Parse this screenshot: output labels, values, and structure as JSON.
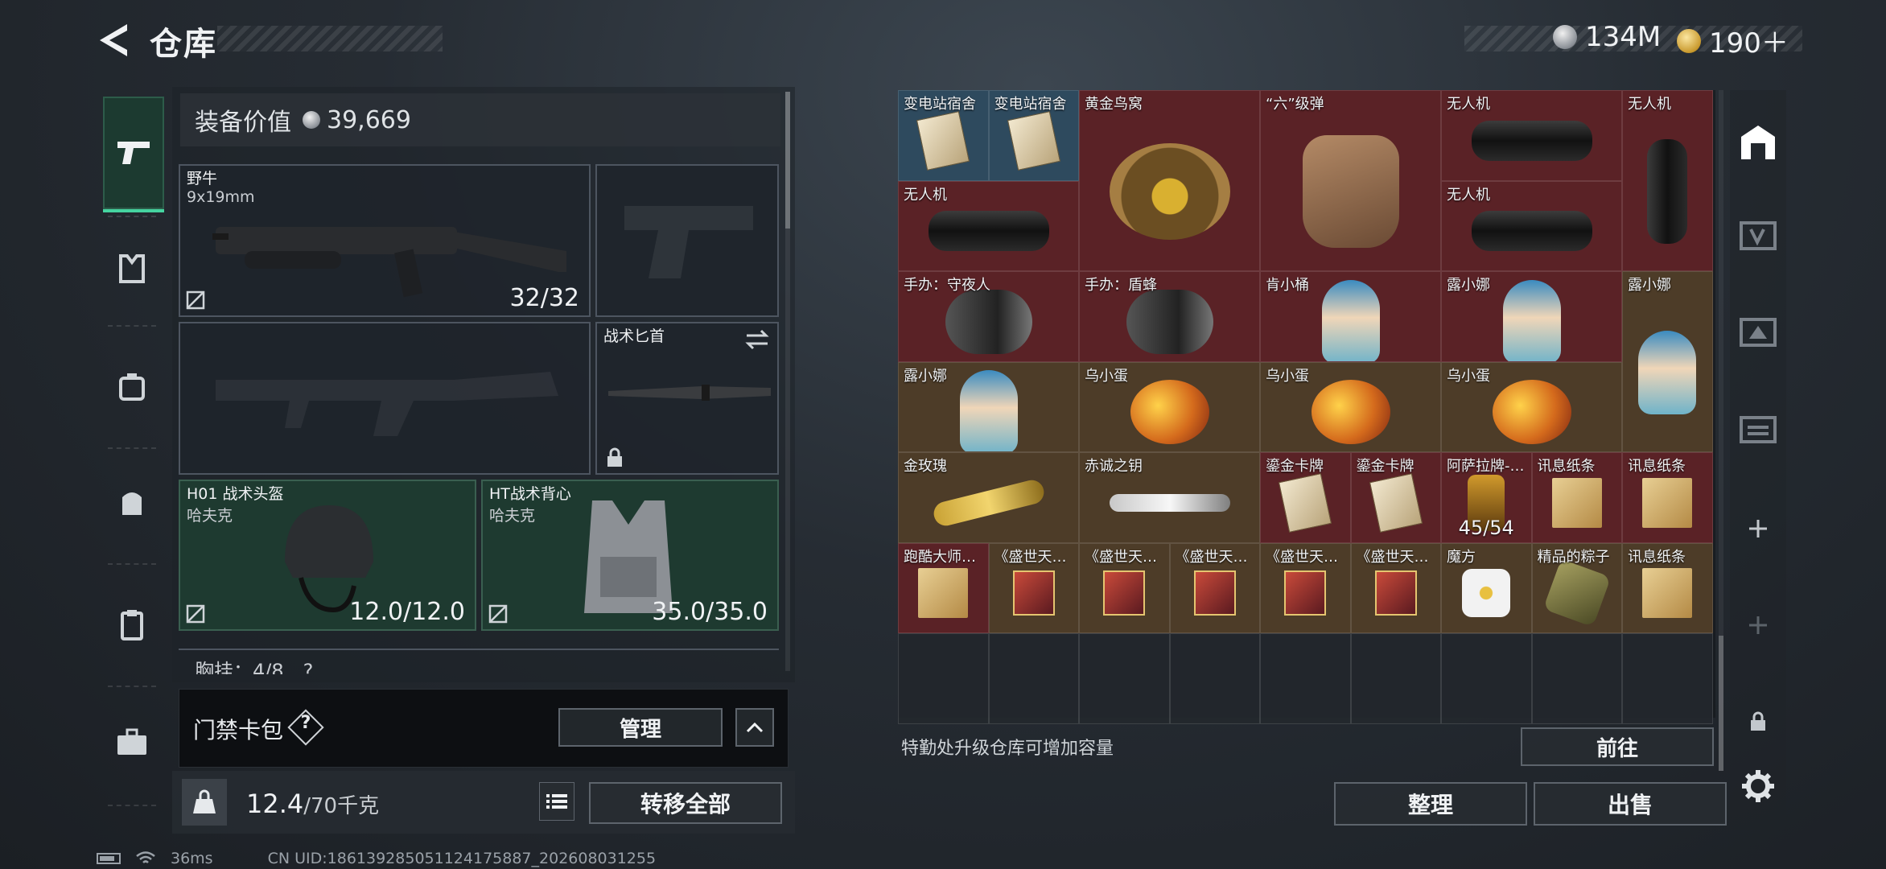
{
  "header": {
    "title": "仓库",
    "currency_silver": "134M",
    "currency_gold": "190＋"
  },
  "left_nav": {
    "items": [
      "weapon-icon",
      "armor-icon",
      "backpack-icon",
      "bag-icon",
      "vest-icon",
      "case-icon"
    ]
  },
  "equipment": {
    "value_label": "装备价值",
    "value": "39,669",
    "primary_weapon": {
      "name": "野牛",
      "caliber": "9x19mm",
      "durability": "32/32"
    },
    "melee": {
      "name": "战术匕首"
    },
    "helmet": {
      "name": "H01 战术头盔",
      "brand": "哈夫克",
      "durability": "12.0/12.0"
    },
    "armor": {
      "name": "HT战术背心",
      "brand": "哈夫克",
      "durability": "35.0/35.0"
    },
    "next_section_partial": "胸挂：4/8　?"
  },
  "keycard": {
    "label": "门禁卡包",
    "help": "?",
    "manage_button": "管理"
  },
  "weight": {
    "current": "12.4",
    "capacity": "/70千克",
    "transfer_button": "转移全部"
  },
  "warehouse": {
    "rows": [
      [
        {
          "label": "变电站宿舍",
          "art": "card",
          "bg": "blue"
        },
        {
          "label": "变电站宿舍",
          "art": "card",
          "bg": "blue"
        },
        {
          "label": "黄金鸟窝",
          "art": "nest",
          "bg": "red"
        },
        {
          "label": "“六”级弹",
          "art": "hand",
          "bg": "red"
        },
        {
          "label": "无人机",
          "art": "tube",
          "bg": "red"
        },
        {
          "label": "无人机",
          "art": "tube-v",
          "bg": "red"
        }
      ],
      [
        {
          "label": "无人机",
          "art": "tube",
          "bg": "red"
        },
        {
          "label": "无人机",
          "art": "tube",
          "bg": "red"
        }
      ],
      [
        {
          "label": "手办：守夜人",
          "art": "figd",
          "bg": "red"
        },
        {
          "label": "手办：盾蜂",
          "art": "figd",
          "bg": "red"
        },
        {
          "label": "肯小桶",
          "art": "fig",
          "bg": "red"
        },
        {
          "label": "露小娜",
          "art": "fig",
          "bg": "red"
        },
        {
          "label": "露小娜",
          "art": "fig",
          "bg": "gold"
        }
      ],
      [
        {
          "label": "露小娜",
          "art": "fig",
          "bg": "gold"
        },
        {
          "label": "乌小蛋",
          "art": "egg",
          "bg": "gold"
        },
        {
          "label": "乌小蛋",
          "art": "egg",
          "bg": "gold"
        },
        {
          "label": "乌小蛋",
          "art": "egg",
          "bg": "gold"
        }
      ],
      [
        {
          "label": "金玫瑰",
          "art": "rose",
          "bg": "gold"
        },
        {
          "label": "赤诚之钥",
          "art": "key",
          "bg": "gold"
        },
        {
          "label": "鎏金卡牌",
          "art": "card",
          "bg": "red"
        },
        {
          "label": "鎏金卡牌",
          "art": "card",
          "bg": "red"
        },
        {
          "label": "阿萨拉牌-…",
          "art": "badge",
          "bg": "red",
          "count": "45/54"
        },
        {
          "label": "讯息纸条",
          "art": "doc",
          "bg": "red"
        },
        {
          "label": "讯息纸条",
          "art": "doc",
          "bg": "red"
        }
      ],
      [
        {
          "label": "跑酷大师…",
          "art": "doc",
          "bg": "red"
        },
        {
          "label": "《盛世天…",
          "art": "book",
          "bg": "gold"
        },
        {
          "label": "《盛世天…",
          "art": "book",
          "bg": "gold"
        },
        {
          "label": "《盛世天…",
          "art": "book",
          "bg": "gold"
        },
        {
          "label": "《盛世天…",
          "art": "book",
          "bg": "gold"
        },
        {
          "label": "《盛世天…",
          "art": "book",
          "bg": "gold"
        },
        {
          "label": "魔方",
          "art": "cube",
          "bg": "gold"
        },
        {
          "label": "精品的粽子",
          "art": "rice",
          "bg": "gold"
        },
        {
          "label": "讯息纸条",
          "art": "doc",
          "bg": "gold"
        }
      ]
    ],
    "upgrade_hint": "特勤处升级仓库可增加容量",
    "goto_button": "前往",
    "sort_button": "整理",
    "sell_button": "出售"
  },
  "right_nav": {
    "items": [
      "warehouse-icon",
      "video-icon",
      "camera-icon",
      "storage-icon",
      "add-icon",
      "add-disabled-icon",
      "lock-icon",
      "settings-icon"
    ]
  },
  "status": {
    "ping": "36ms",
    "uid": "CN UID:186139285051124175887_202608031255"
  },
  "colors": {
    "accent_green": "#45d4a0",
    "cell_red": "#5a2226",
    "cell_gold": "#4d3c28",
    "cell_blue": "#2e4a5e"
  }
}
